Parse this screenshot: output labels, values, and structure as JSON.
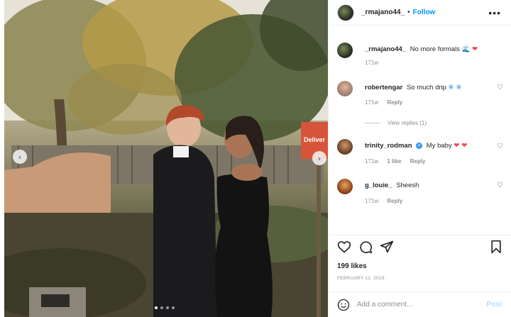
{
  "post": {
    "username": "_rmajano44_",
    "separator": "•",
    "follow_label": "Follow",
    "more_icon": "more-horizontal-icon",
    "photo": {
      "sign_text": "Deliver",
      "carousel_dots": 4,
      "active_dot": 0
    }
  },
  "caption": {
    "username": "_rmajano44_",
    "text": "No more formals",
    "emoji_1": "🌊",
    "emoji_2": "❤",
    "time": "171w"
  },
  "comments": [
    {
      "username": "robertengar",
      "text": "So much drip",
      "emoji": "❄ ❄",
      "time": "171w",
      "likes": "",
      "reply": "Reply"
    },
    {
      "username": "trinity_rodman",
      "verified_icon": "✔",
      "text": "My baby",
      "emoji": "❤ ❤",
      "time": "171w",
      "likes": "1 like",
      "reply": "Reply"
    },
    {
      "username": "g_louie_",
      "text": "Sheesh",
      "emoji": "",
      "time": "171w",
      "likes": "",
      "reply": "Reply"
    }
  ],
  "view_replies": "View replies (1)",
  "actions": {
    "like_icon": "heart-icon",
    "comment_icon": "comment-icon",
    "share_icon": "share-icon",
    "save_icon": "bookmark-icon"
  },
  "likes_count": "199 likes",
  "date": "FEBRUARY 11, 2019",
  "add_comment_placeholder": "Add a comment...",
  "post_label": "Post",
  "colors": {
    "accent": "#0095f6",
    "heart_red": "#ed4956",
    "muted": "#8e8e8e",
    "post_disabled": "#b2dffc"
  }
}
